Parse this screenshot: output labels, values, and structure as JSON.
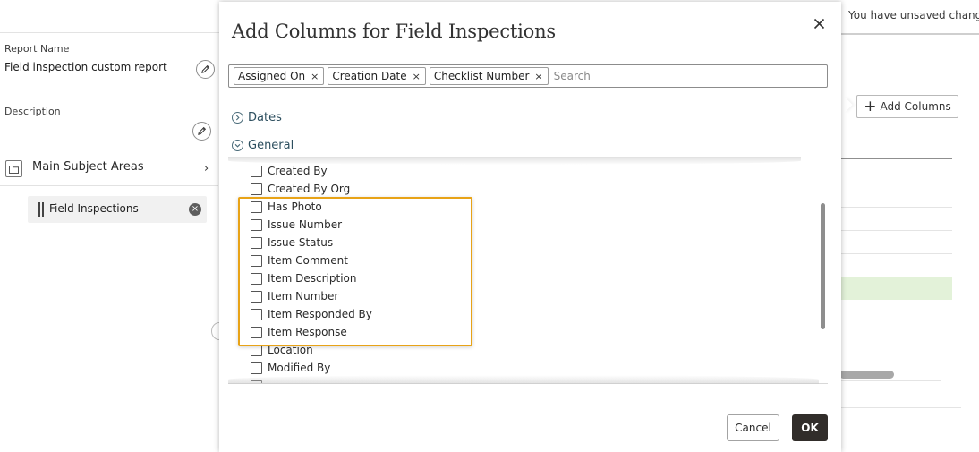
{
  "header": {
    "unsaved_text": "You have unsaved changes"
  },
  "left_panel": {
    "report_name_label": "Report Name",
    "report_name_value": "Field inspection custom report",
    "description_label": "Description",
    "subject_areas_label": "Main Subject Areas",
    "selected_field": "Field Inspections"
  },
  "background": {
    "add_columns_label": "Add Columns"
  },
  "dialog": {
    "title": "Add Columns for Field Inspections",
    "search_placeholder": "Search",
    "chips": [
      {
        "label": "Assigned On"
      },
      {
        "label": "Creation Date"
      },
      {
        "label": "Checklist Number"
      }
    ],
    "sections": [
      {
        "label": "Dates",
        "expanded": false
      },
      {
        "label": "General",
        "expanded": true
      }
    ],
    "items": [
      {
        "label": "Created By",
        "checked": false
      },
      {
        "label": "Created By Org",
        "checked": false
      },
      {
        "label": "Has Photo",
        "checked": false
      },
      {
        "label": "Issue Number",
        "checked": false
      },
      {
        "label": "Issue Status",
        "checked": false
      },
      {
        "label": "Item Comment",
        "checked": false
      },
      {
        "label": "Item Description",
        "checked": false
      },
      {
        "label": "Item Number",
        "checked": false
      },
      {
        "label": "Item Responded By",
        "checked": false
      },
      {
        "label": "Item Response",
        "checked": false
      },
      {
        "label": "Location",
        "checked": false
      },
      {
        "label": "Modified By",
        "checked": false
      }
    ],
    "cancel_label": "Cancel",
    "ok_label": "OK"
  },
  "colors": {
    "highlight": "#e8a317",
    "ok_button": "#312d2a",
    "section_text": "#2d4f5f",
    "selected_row": "#e3f2d9"
  },
  "icons": [
    "edit-icon",
    "folder-icon",
    "chevron-right-icon",
    "drag-handle-icon",
    "remove-icon",
    "close-icon",
    "chip-remove-icon",
    "chevron-right-circle-icon",
    "chevron-down-circle-icon",
    "plus-icon",
    "checkbox-icon"
  ]
}
